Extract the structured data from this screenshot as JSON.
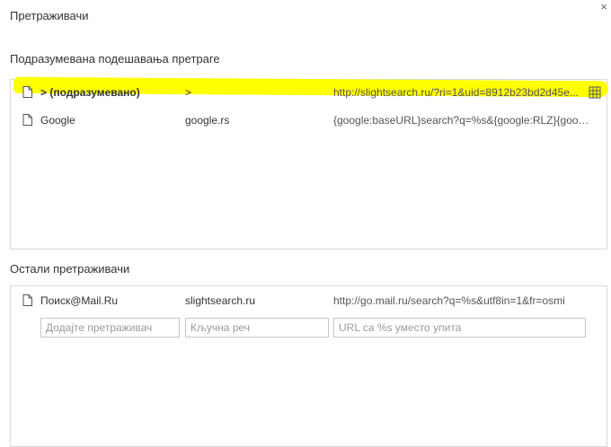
{
  "dialog": {
    "title": "Претраживачи"
  },
  "default_section": {
    "heading": "Подразумевана подешавања претраге",
    "rows": [
      {
        "name": "> (подразумевано)",
        "keyword": ">",
        "url": "http://slightsearch.ru/?ri=1&uid=8912b23bd2d45e...",
        "icon": "document-icon",
        "highlighted": true
      },
      {
        "name": "Google",
        "keyword": "google.rs",
        "url": "{google:baseURL}search?q=%s&{google:RLZ}{goog...",
        "icon": "document-icon"
      }
    ]
  },
  "other_section": {
    "heading": "Остали претраживачи",
    "rows": [
      {
        "name": "Поиск@Mail.Ru",
        "keyword": "slightsearch.ru",
        "url": "http://go.mail.ru/search?q=%s&utf8in=1&fr=osmi",
        "icon": "document-icon"
      }
    ],
    "add_row": {
      "name_placeholder": "Додајте претраживач",
      "keyword_placeholder": "Кључна реч",
      "url_placeholder": "URL са %s уместо упита"
    }
  },
  "colors": {
    "highlight": "#ffff00",
    "border": "#d9d9d9"
  }
}
